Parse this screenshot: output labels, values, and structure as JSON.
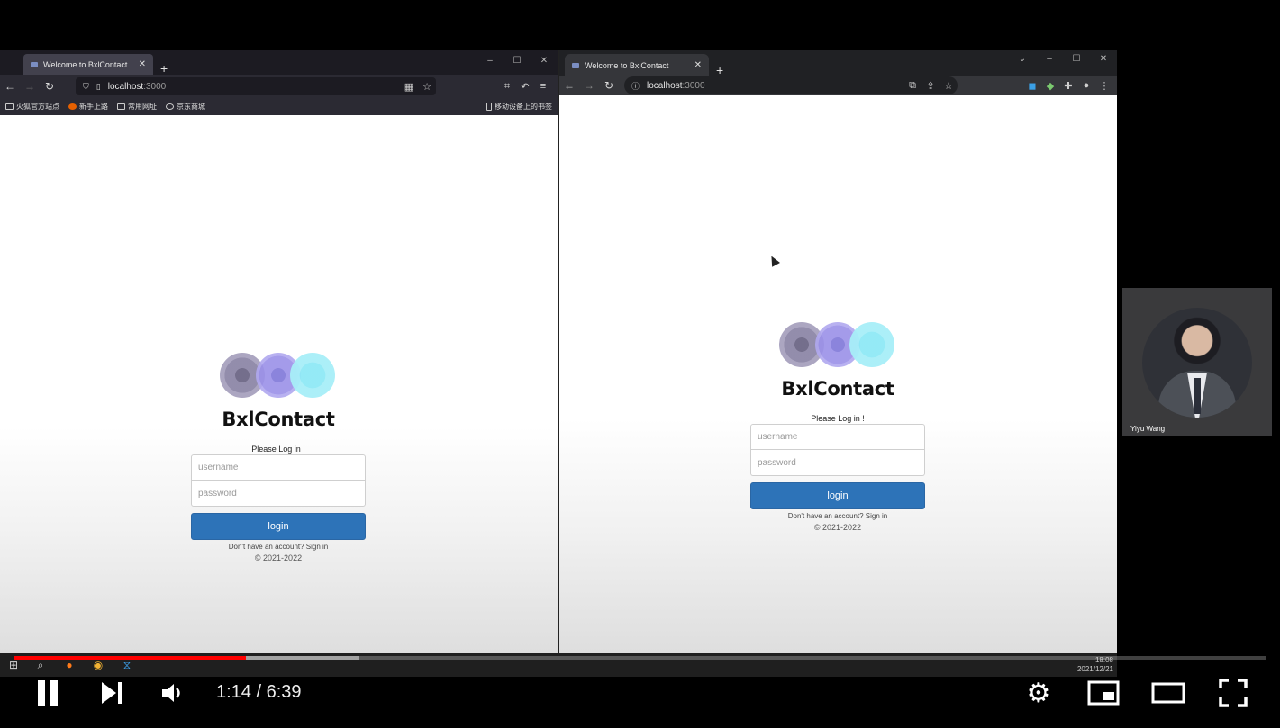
{
  "firefox": {
    "tab_title": "Welcome to BxlContact",
    "url_host": "localhost",
    "url_port": ":3000",
    "bookmarks": [
      "火狐官方站点",
      "新手上路",
      "常用网址",
      "京东商城"
    ],
    "mobile_bookmarks": "移动设备上的书签"
  },
  "chrome": {
    "tab_title": "Welcome to BxlContact",
    "url_host": "localhost",
    "url_port": ":3000"
  },
  "login": {
    "brand": "BxlContact",
    "prompt": "Please Log in !",
    "username_placeholder": "username",
    "password_placeholder": "password",
    "login_label": "login",
    "signup_text": "Don't have an account? Sign in",
    "copyright": "© 2021-2022"
  },
  "taskbar": {
    "time": "18:08",
    "date": "2021/12/21"
  },
  "webcam": {
    "name": "Yiyu Wang"
  },
  "player": {
    "current_time": "1:14",
    "duration": "6:39",
    "time_display": "1:14 / 6:39",
    "played_fraction": 0.185,
    "buffered_fraction": 0.275,
    "progress_color": "#ff0000"
  },
  "colors": {
    "login_button": "#2d73b8",
    "firefox_toolbar": "#2b2a33",
    "chrome_toolbar": "#35363a"
  }
}
